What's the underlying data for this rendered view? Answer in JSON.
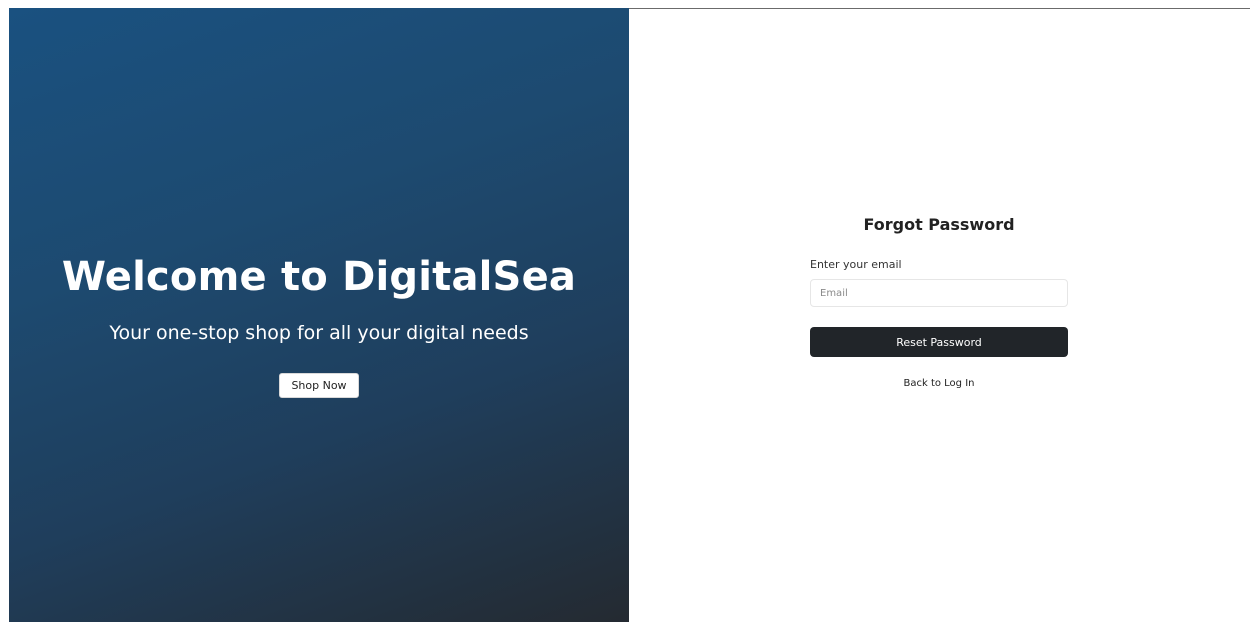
{
  "hero": {
    "title": "Welcome to DigitalSea",
    "subtitle": "Your one-stop shop for all your digital needs",
    "shop_button_label": "Shop Now"
  },
  "form": {
    "title": "Forgot Password",
    "email_label": "Enter your email",
    "email_value": "",
    "email_placeholder": "Email",
    "reset_button_label": "Reset Password",
    "back_link_label": "Back to Log In"
  },
  "colors": {
    "hero_gradient_start": "#1a5180",
    "hero_gradient_end": "#242a31",
    "primary_button": "#212529",
    "text_dark": "#222222"
  }
}
